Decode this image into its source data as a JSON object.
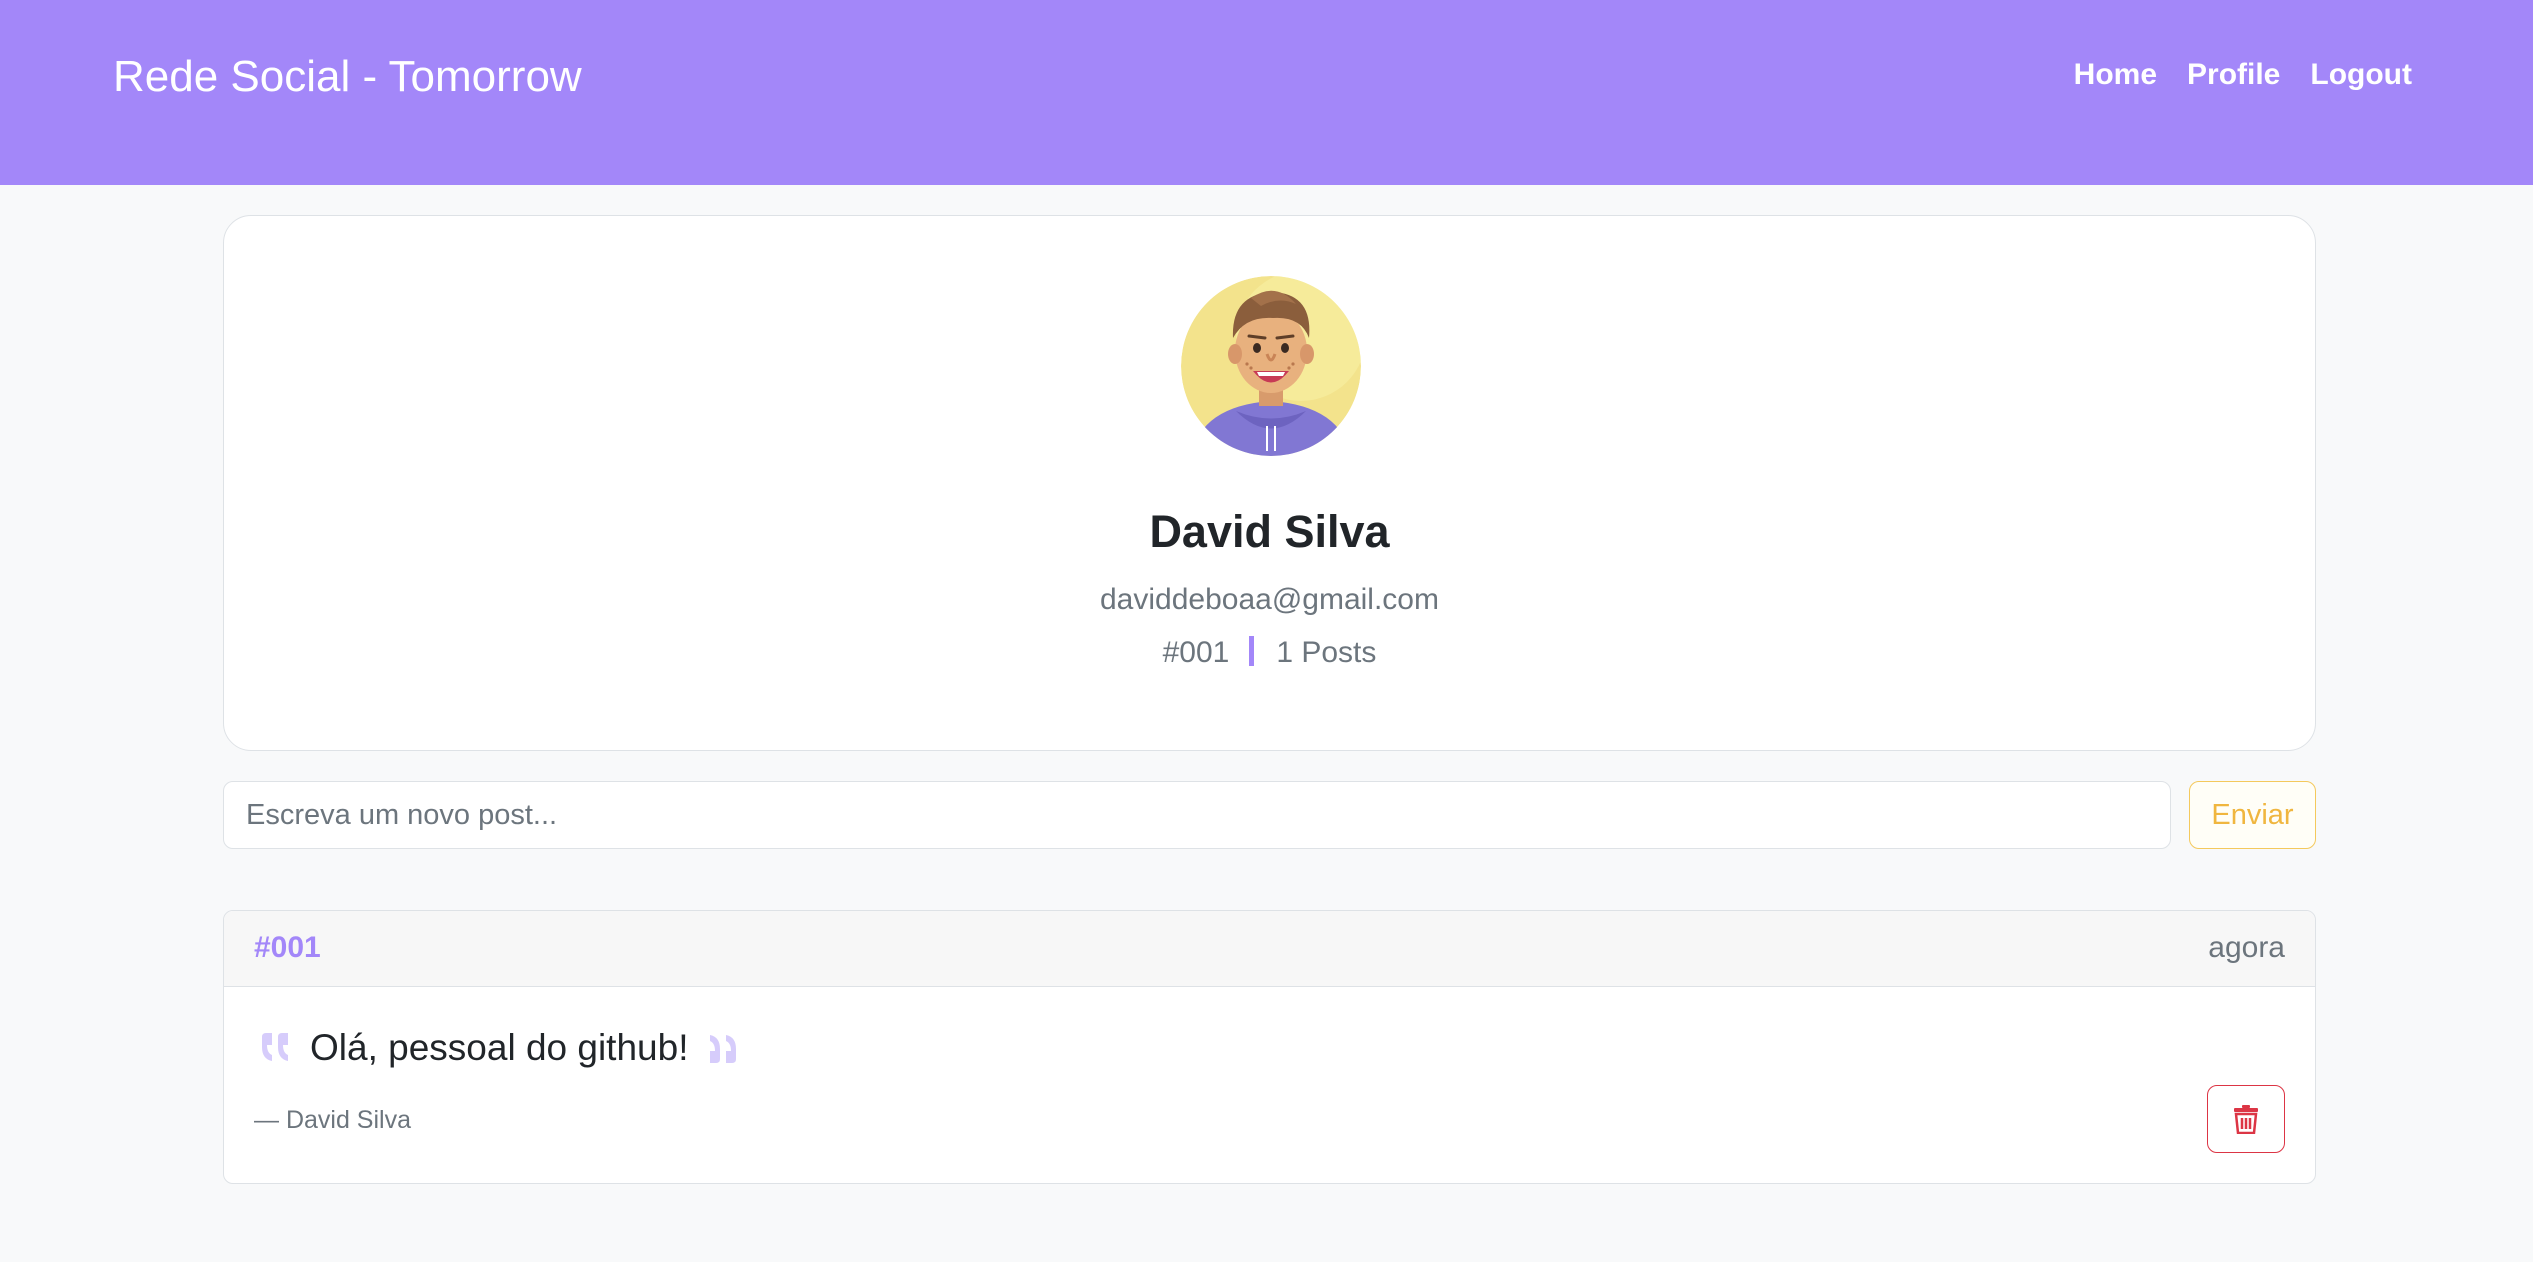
{
  "navbar": {
    "brand": "Rede Social - Tomorrow",
    "links": [
      {
        "label": "Home"
      },
      {
        "label": "Profile"
      },
      {
        "label": "Logout"
      }
    ],
    "background_color": "#a387f9"
  },
  "profile": {
    "avatar_icon": "avatar-illustration",
    "name": "David Silva",
    "email": "daviddeboaa@gmail.com",
    "user_id": "#001",
    "posts_count": "1 Posts"
  },
  "composer": {
    "placeholder": "Escreva um novo post...",
    "value": "",
    "send_label": "Enviar"
  },
  "posts": [
    {
      "id": "#001",
      "time": "agora",
      "text": "Olá, pessoal do github!",
      "author": "— David Silva",
      "delete_icon": "trash-icon"
    }
  ],
  "colors": {
    "accent": "#a387f9",
    "warning": "#f0b63f",
    "danger": "#dc3545"
  }
}
